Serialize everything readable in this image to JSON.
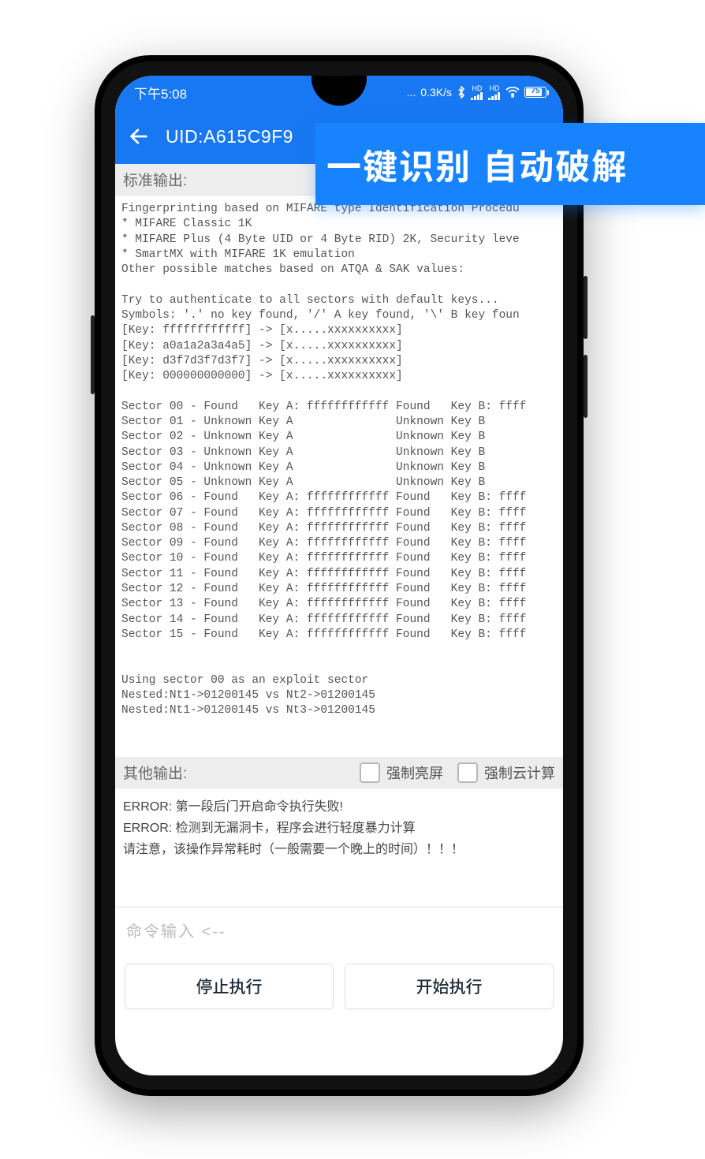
{
  "banner_text": "一键识别 自动破解",
  "statusbar": {
    "time": "下午5:08",
    "net_speed": "0.3K/s",
    "battery_pct": "75"
  },
  "appbar": {
    "uid_label": "UID:A615C9F9"
  },
  "labels": {
    "stdout": "标准输出:",
    "other_out": "其他输出:",
    "force_screen_on": "强制亮屏",
    "force_cloud": "强制云计算",
    "cmd_placeholder": "命令输入 <--",
    "stop": "停止执行",
    "start": "开始执行"
  },
  "console_main": "Fingerprinting based on MIFARE type Identification Procedu\n* MIFARE Classic 1K\n* MIFARE Plus (4 Byte UID or 4 Byte RID) 2K, Security leve\n* SmartMX with MIFARE 1K emulation\nOther possible matches based on ATQA & SAK values:\n\nTry to authenticate to all sectors with default keys...\nSymbols: '.' no key found, '/' A key found, '\\' B key foun\n[Key: ffffffffffff] -> [x.....xxxxxxxxxx]\n[Key: a0a1a2a3a4a5] -> [x.....xxxxxxxxxx]\n[Key: d3f7d3f7d3f7] -> [x.....xxxxxxxxxx]\n[Key: 000000000000] -> [x.....xxxxxxxxxx]\n\nSector 00 - Found   Key A: ffffffffffff Found   Key B: ffff\nSector 01 - Unknown Key A               Unknown Key B\nSector 02 - Unknown Key A               Unknown Key B\nSector 03 - Unknown Key A               Unknown Key B\nSector 04 - Unknown Key A               Unknown Key B\nSector 05 - Unknown Key A               Unknown Key B\nSector 06 - Found   Key A: ffffffffffff Found   Key B: ffff\nSector 07 - Found   Key A: ffffffffffff Found   Key B: ffff\nSector 08 - Found   Key A: ffffffffffff Found   Key B: ffff\nSector 09 - Found   Key A: ffffffffffff Found   Key B: ffff\nSector 10 - Found   Key A: ffffffffffff Found   Key B: ffff\nSector 11 - Found   Key A: ffffffffffff Found   Key B: ffff\nSector 12 - Found   Key A: ffffffffffff Found   Key B: ffff\nSector 13 - Found   Key A: ffffffffffff Found   Key B: ffff\nSector 14 - Found   Key A: ffffffffffff Found   Key B: ffff\nSector 15 - Found   Key A: ffffffffffff Found   Key B: ffff\n\n\nUsing sector 00 as an exploit sector\nNested:Nt1->01200145 vs Nt2->01200145\nNested:Nt1->01200145 vs Nt3->01200145",
  "errors": {
    "l1": "ERROR:  第一段后门开启命令执行失败!",
    "l2": "ERROR:  检测到无漏洞卡，程序会进行轻度暴力计算",
    "l3": "请注意，该操作异常耗时（一般需要一个晚上的时间）！！！"
  }
}
